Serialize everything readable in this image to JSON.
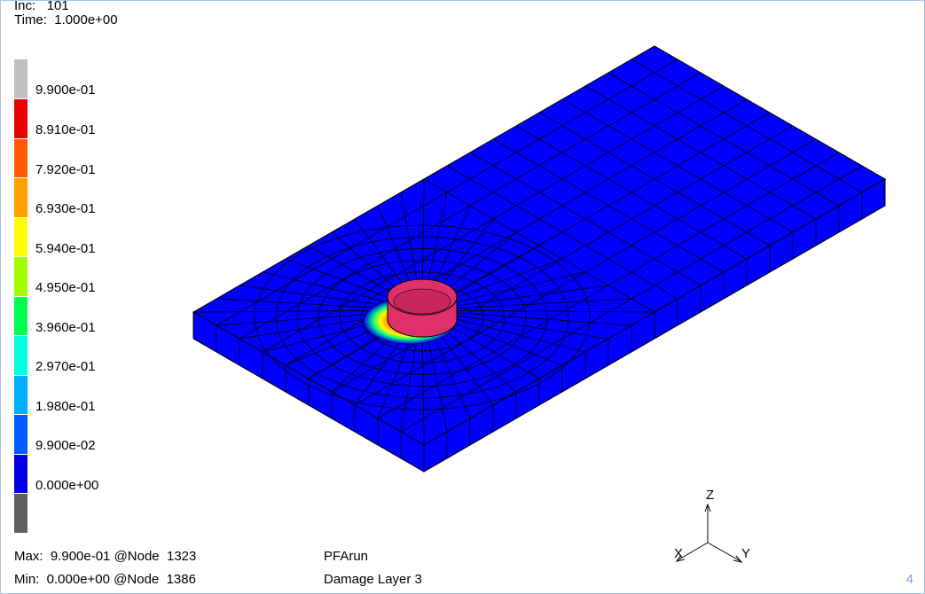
{
  "header": {
    "inc_label": "Inc:",
    "inc_value": "101",
    "time_label": "Time:",
    "time_value": "1.000e+00"
  },
  "legend": {
    "labels": [
      "9.900e-01",
      "8.910e-01",
      "7.920e-01",
      "6.930e-01",
      "5.940e-01",
      "4.950e-01",
      "3.960e-01",
      "2.970e-01",
      "1.980e-01",
      "9.900e-02",
      "0.000e+00"
    ],
    "colors": [
      "#c0c0c0",
      "#ee0000",
      "#ff5a00",
      "#ffa000",
      "#ffff00",
      "#a0ff00",
      "#00ff50",
      "#00ffe0",
      "#00b0ff",
      "#005aff",
      "#0000e6",
      "#606060"
    ]
  },
  "footer": {
    "max_text": "Max:  9.900e-01 @Node  1323",
    "min_text": "Min:  0.000e+00 @Node  1386",
    "job_name": "PFArun",
    "result_name": "Damage Layer 3"
  },
  "axes": {
    "z": "Z",
    "x": "X",
    "y": "Y"
  },
  "viewport_number": "4",
  "colors": {
    "plate": "#0000ff",
    "pin": "#e0306a",
    "mesh": "#000000"
  }
}
